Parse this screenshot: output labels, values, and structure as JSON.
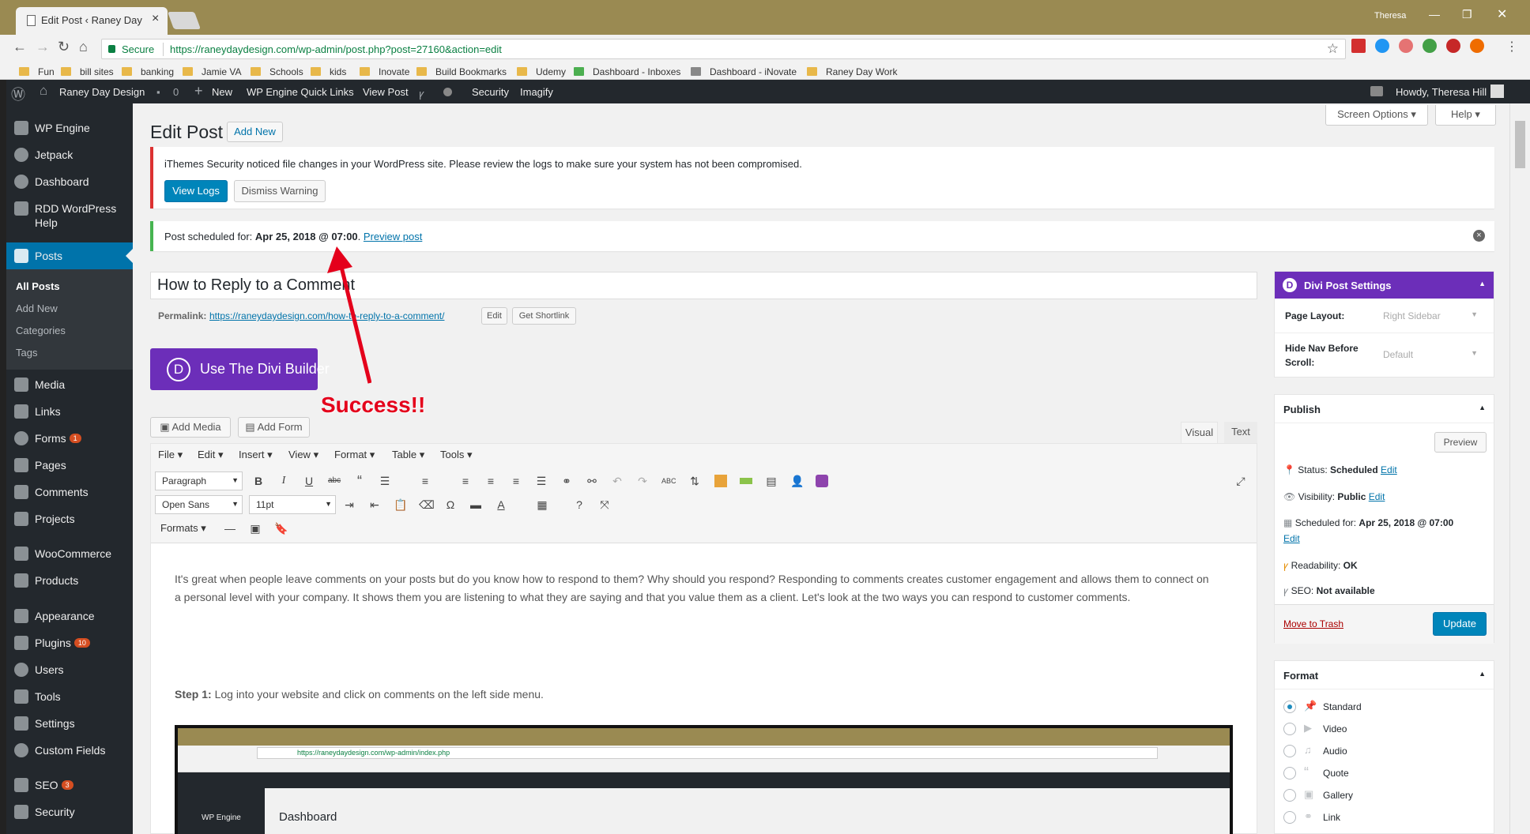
{
  "browser": {
    "tab_title": "Edit Post ‹ Raney Day De",
    "profile": "Theresa",
    "secure_label": "Secure",
    "url": "https://raneydaydesign.com/wp-admin/post.php?post=27160&action=edit",
    "bookmarks": [
      "Fun",
      "bill sites",
      "banking",
      "Jamie VA",
      "Schools",
      "kids",
      "Inovate",
      "Build Bookmarks",
      "Udemy",
      "Dashboard - Inboxes",
      "Dashboard - iNovate",
      "Raney Day Work"
    ]
  },
  "adminbar": {
    "site": "Raney Day Design",
    "comments": "0",
    "new": "New",
    "quick_links": "WP Engine Quick Links",
    "view_post": "View Post",
    "security": "Security",
    "imagify": "Imagify",
    "howdy": "Howdy, Theresa Hill"
  },
  "sidebar": {
    "items": [
      {
        "label": "WP Engine"
      },
      {
        "label": "Jetpack"
      },
      {
        "label": "Dashboard"
      },
      {
        "label": "RDD WordPress Help"
      },
      {
        "label": "Posts"
      },
      {
        "label": "Media"
      },
      {
        "label": "Links"
      },
      {
        "label": "Forms",
        "badge": "1"
      },
      {
        "label": "Pages"
      },
      {
        "label": "Comments"
      },
      {
        "label": "Projects"
      },
      {
        "label": "WooCommerce"
      },
      {
        "label": "Products"
      },
      {
        "label": "Appearance"
      },
      {
        "label": "Plugins",
        "badge": "10"
      },
      {
        "label": "Users"
      },
      {
        "label": "Tools"
      },
      {
        "label": "Settings"
      },
      {
        "label": "Custom Fields"
      },
      {
        "label": "SEO",
        "badge": "3"
      },
      {
        "label": "Security"
      }
    ],
    "posts_sub": [
      "All Posts",
      "Add New",
      "Categories",
      "Tags"
    ]
  },
  "main": {
    "title": "Edit Post",
    "add_new": "Add New",
    "screen_options": "Screen Options",
    "help": "Help",
    "notice_security": "iThemes Security noticed file changes in your WordPress site. Please review the logs to make sure your system has not been compromised.",
    "view_logs": "View Logs",
    "dismiss_warning": "Dismiss Warning",
    "scheduled_prefix": "Post scheduled for: ",
    "scheduled_date": "Apr 25, 2018 @ 07:00",
    "preview_post": "Preview post",
    "post_title": "How to Reply to a Comment",
    "permalink_label": "Permalink:",
    "permalink": "https://raneydaydesign.com/how-to-reply-to-a-comment/",
    "edit": "Edit",
    "get_shortlink": "Get Shortlink",
    "divi_builder": "Use The Divi Builder",
    "annotation": "Success!!",
    "add_media": "Add Media",
    "add_form": "Add Form",
    "tab_visual": "Visual",
    "tab_text": "Text",
    "menus": [
      "File",
      "Edit",
      "Insert",
      "View",
      "Format",
      "Table",
      "Tools"
    ],
    "paragraph": "Paragraph",
    "font": "Open Sans",
    "size": "11pt",
    "formats": "Formats",
    "content_p1": "It's great when people leave comments on your posts but do you know how to respond to them?  Why should you respond? Responding to comments creates customer engagement and allows them to connect on a personal level with your company.  It shows them you are listening to what they are saying and that you value them as a client. Let's look at the two ways you can respond to customer comments.",
    "step1_label": "Step 1:",
    "step1_text": "Log into your website and click on comments on the left side menu.",
    "embed_url": "https://raneydaydesign.com/wp-admin/index.php",
    "embed_title": "Dashboard",
    "embed_menu": "WP Engine"
  },
  "divi_settings": {
    "title": "Divi Post Settings",
    "page_layout_label": "Page Layout:",
    "page_layout_value": "Right Sidebar",
    "hide_nav_label": "Hide Nav Before Scroll:",
    "hide_nav_value": "Default"
  },
  "publish": {
    "title": "Publish",
    "preview": "Preview",
    "status_label": "Status:",
    "status": "Scheduled",
    "visibility_label": "Visibility:",
    "visibility": "Public",
    "scheduled_label": "Scheduled for:",
    "scheduled": "Apr 25, 2018 @ 07:00",
    "edit": "Edit",
    "readability_label": "Readability:",
    "readability": "OK",
    "seo_label": "SEO:",
    "seo": "Not available",
    "trash": "Move to Trash",
    "update": "Update"
  },
  "format": {
    "title": "Format",
    "options": [
      "Standard",
      "Video",
      "Audio",
      "Quote",
      "Gallery",
      "Link"
    ]
  },
  "colors": {
    "wp_dark": "#23282d",
    "wp_blue": "#0073aa",
    "divi_purple": "#6c2eb9",
    "notice_red": "#dc3232",
    "notice_green": "#46b450",
    "annotation_red": "#e4001b"
  }
}
